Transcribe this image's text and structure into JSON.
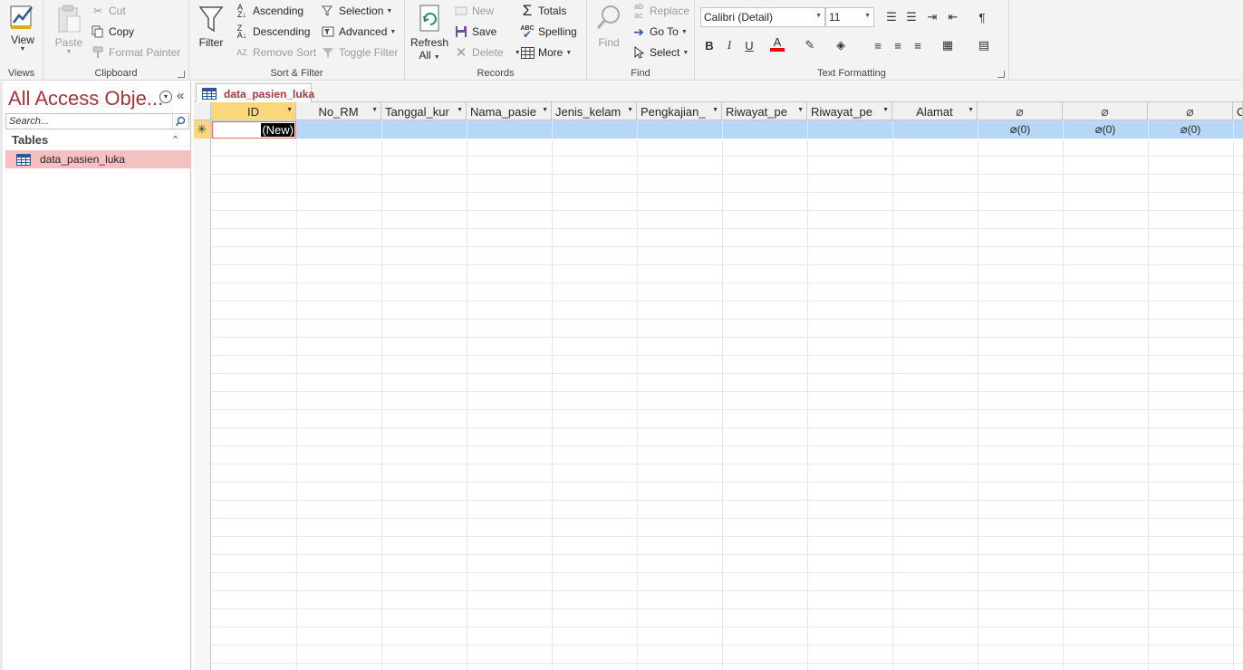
{
  "ribbon": {
    "views": {
      "label": "Views",
      "view_btn": "View"
    },
    "clipboard": {
      "label": "Clipboard",
      "paste": "Paste",
      "cut": "Cut",
      "copy": "Copy",
      "format_painter": "Format Painter"
    },
    "sort_filter": {
      "label": "Sort & Filter",
      "filter": "Filter",
      "ascending": "Ascending",
      "descending": "Descending",
      "remove_sort": "Remove Sort",
      "selection": "Selection",
      "advanced": "Advanced",
      "toggle_filter": "Toggle Filter"
    },
    "records": {
      "label": "Records",
      "refresh": "Refresh",
      "refresh_all": "All",
      "new": "New",
      "save": "Save",
      "delete": "Delete",
      "totals": "Totals",
      "spelling": "Spelling",
      "more": "More"
    },
    "find": {
      "label": "Find",
      "find": "Find",
      "replace": "Replace",
      "goto": "Go To",
      "select": "Select"
    },
    "text_formatting": {
      "label": "Text Formatting",
      "font": "Calibri (Detail)",
      "size": "11",
      "bold": "B",
      "italic": "I",
      "underline": "U",
      "font_color_letter": "A"
    }
  },
  "nav": {
    "title": "All Access Obje...",
    "search_placeholder": "Search...",
    "section": "Tables",
    "items": [
      {
        "label": "data_pasien_luka"
      }
    ]
  },
  "document": {
    "tab": "data_pasien_luka",
    "columns": [
      "ID",
      "No_RM",
      "Tanggal_kur",
      "Nama_pasie",
      "Jenis_kelam",
      "Pengkajian_",
      "Riwayat_pe",
      "Riwayat_pe",
      "Alamat"
    ],
    "new_row_value": "(New)",
    "new_row_marker": "✳",
    "attachment_cells": [
      "(0)",
      "(0)",
      "(0)"
    ],
    "last_col_partial": "C"
  },
  "colors": {
    "accent": "#a4373a",
    "active_header": "#fbd77c",
    "row_highlight": "#b7d7f6",
    "nav_selected": "#f4c0c2"
  }
}
